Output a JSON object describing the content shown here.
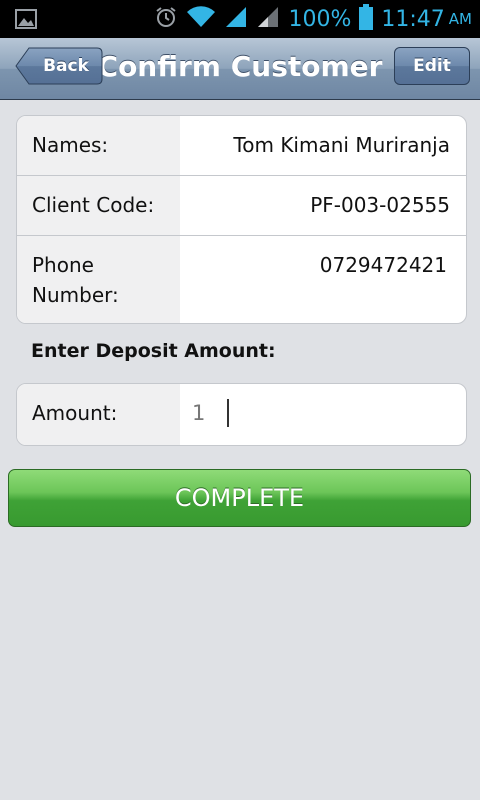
{
  "status_bar": {
    "battery_percent": "100%",
    "time": "11:47",
    "ampm": "AM",
    "accent_color": "#33b5e5",
    "icons": [
      "image-icon",
      "alarm-icon",
      "wifi-icon",
      "signal-icon",
      "signal-icon-2",
      "battery-icon"
    ]
  },
  "nav": {
    "back_label": "Back",
    "title": "Confirm Customer",
    "edit_label": "Edit"
  },
  "customer": {
    "names_label": "Names:",
    "names_value": "Tom Kimani Muriranja",
    "client_code_label": "Client Code:",
    "client_code_value": "PF-003-02555",
    "phone_label_line1": "Phone",
    "phone_label_line2": "Number:",
    "phone_value": "0729472421"
  },
  "deposit": {
    "section_label": "Enter Deposit Amount:",
    "amount_label": "Amount:",
    "amount_value": "1"
  },
  "actions": {
    "complete_label": "COMPLETE",
    "complete_color": "#3fa236"
  }
}
